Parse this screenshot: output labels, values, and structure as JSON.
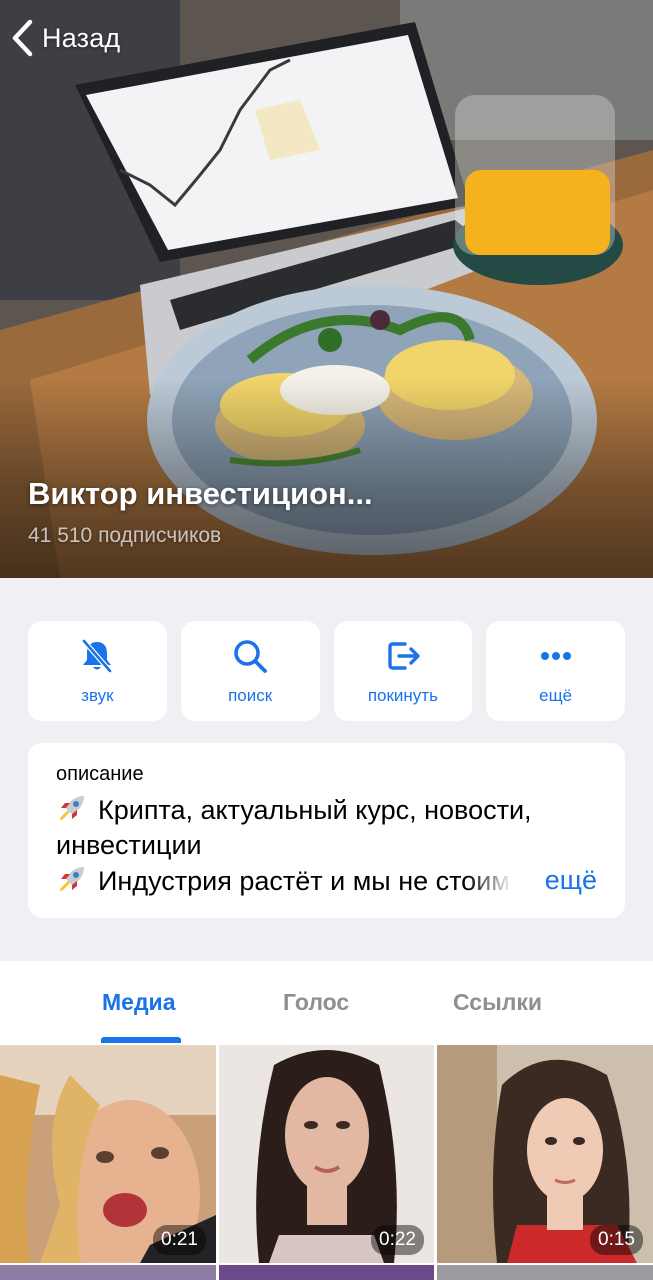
{
  "header": {
    "back_label": "Назад",
    "channel_title": "Виктор инвестицион...",
    "subscribers": "41 510 подписчиков"
  },
  "actions": [
    {
      "label": "звук",
      "icon": "bell-slash-icon"
    },
    {
      "label": "поиск",
      "icon": "search-icon"
    },
    {
      "label": "покинуть",
      "icon": "leave-icon"
    },
    {
      "label": "ещё",
      "icon": "more-dots-icon"
    }
  ],
  "description": {
    "title": "описание",
    "line1": "Крипта, актуальный курс, новости,",
    "line2": "инвестиции",
    "line3": "Индустрия растёт и мы не стоим",
    "more": "ещё",
    "emoji": "rocket-icon"
  },
  "tabs": [
    {
      "label": "Медиа",
      "active": true
    },
    {
      "label": "Голос",
      "active": false
    },
    {
      "label": "Ссылки",
      "active": false
    }
  ],
  "media": [
    {
      "duration": "0:21"
    },
    {
      "duration": "0:22"
    },
    {
      "duration": "0:15"
    }
  ],
  "colors": {
    "accent": "#1a73e8",
    "background": "#efeff4",
    "card": "#ffffff"
  }
}
